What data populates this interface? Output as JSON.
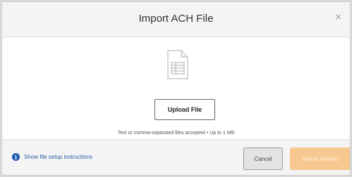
{
  "dialog": {
    "title": "Import ACH File",
    "close_symbol": "×"
  },
  "upload": {
    "icon": "file-spreadsheet-icon",
    "button_label": "Upload File",
    "hint": "Text or comma-separated files accepted  •  Up to 1 MB"
  },
  "footer": {
    "info_icon": "info-icon",
    "info_symbol": "i",
    "instructions_label": "Show file setup instructions",
    "cancel_label": "Cancel",
    "import_label": "Import Payees",
    "import_enabled": false
  },
  "colors": {
    "link": "#2a5aa8",
    "info_icon": "#1e5bb0",
    "import_button_disabled": "#f7c990",
    "cancel_button": "#e3e3e3"
  }
}
